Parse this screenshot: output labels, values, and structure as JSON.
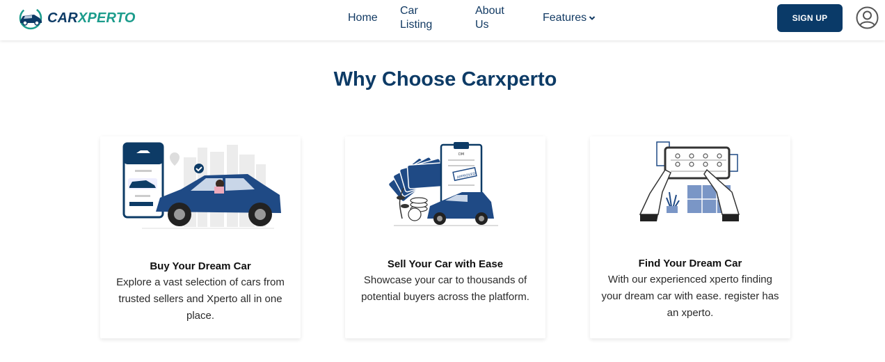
{
  "brand": {
    "name_part1": "CAR",
    "name_part2": "XPERTO",
    "logo_icon": "car-logo-icon"
  },
  "nav": {
    "home": "Home",
    "car_listing": "Car Listing",
    "about_us": "About Us",
    "features": "Features"
  },
  "header": {
    "signup_label": "SIGN UP",
    "avatar_icon": "user-avatar-icon"
  },
  "section": {
    "title": "Why Choose Carxperto"
  },
  "cards": [
    {
      "title": "Buy Your Dream Car",
      "description": "Explore a vast selection of cars from trusted sellers and Xperto all in one place.",
      "icon": "buy-car-illustration"
    },
    {
      "title": "Sell Your Car with Ease",
      "description": "Showcase your car to thousands of potential buyers across the platform.",
      "icon": "sell-car-illustration"
    },
    {
      "title": "Find Your Dream Car",
      "description": "With our experienced xperto finding your dream car with ease. register has an xperto.",
      "icon": "find-car-illustration"
    }
  ],
  "colors": {
    "primary": "#0d3b66",
    "accent": "#1c9c8c",
    "button": "#0a3a68"
  }
}
